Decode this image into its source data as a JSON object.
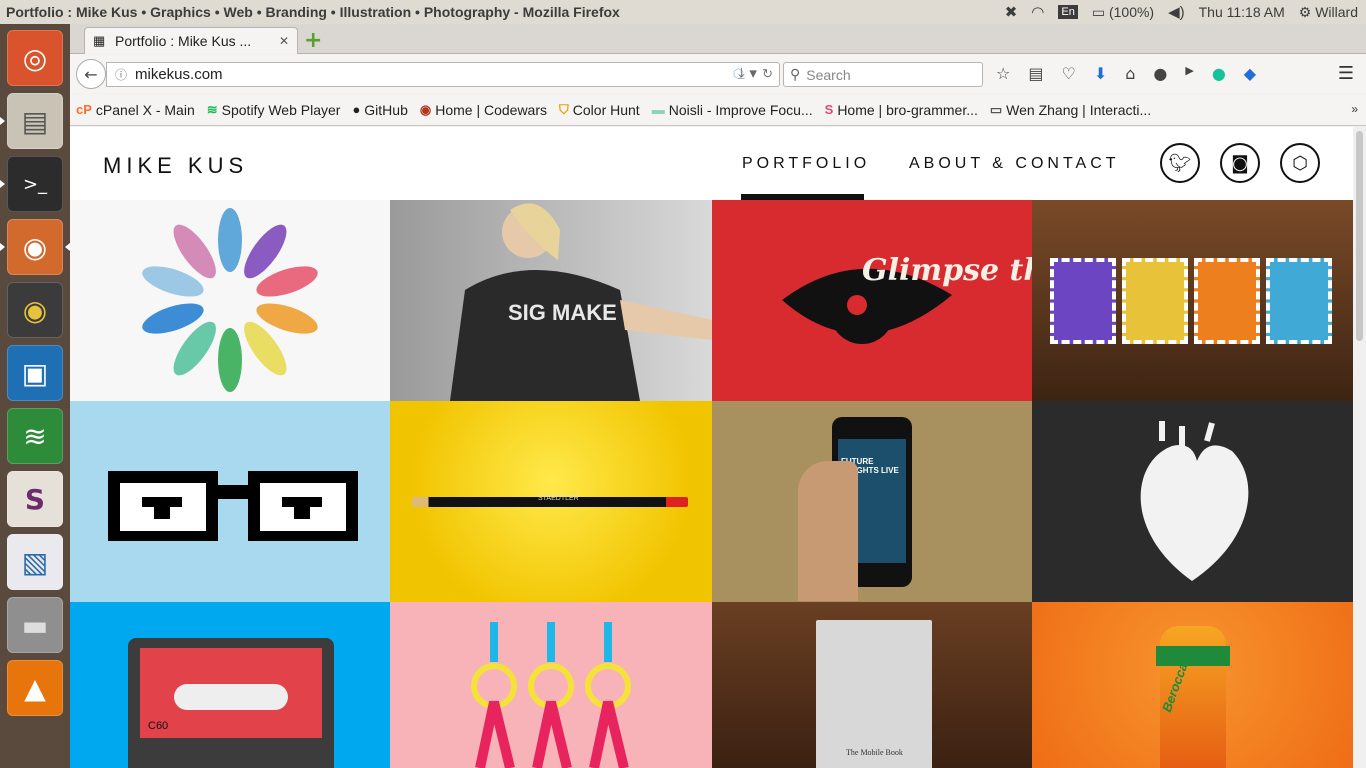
{
  "window": {
    "title": "Portfolio : Mike Kus • Graphics • Web • Branding • Illustration • Photography - Mozilla Firefox"
  },
  "indicators": {
    "lang": "En",
    "battery": "(100%)",
    "clock": "Thu 11:18 AM",
    "user": "Willard"
  },
  "launcher": {
    "items": [
      "ubuntu-dash",
      "files",
      "terminal",
      "firefox",
      "chrome",
      "app-grid",
      "spotify",
      "slack",
      "libreoffice-impress",
      "disk",
      "vlc"
    ]
  },
  "browser": {
    "tab_label": "Portfolio : Mike Kus ...",
    "url": "mikekus.com",
    "search_placeholder": "Search"
  },
  "bookmarks": [
    {
      "icon": "cP",
      "label": "cPanel X - Main",
      "color": "#ff6c2c"
    },
    {
      "icon": "≋",
      "label": "Spotify Web Player",
      "color": "#1db954"
    },
    {
      "icon": "●",
      "label": "GitHub",
      "color": "#222222"
    },
    {
      "icon": "◉",
      "label": "Home | Codewars",
      "color": "#b1361e"
    },
    {
      "icon": "⛉",
      "label": "Color Hunt",
      "color": "#e6a100"
    },
    {
      "icon": "▬",
      "label": "Noisli - Improve Focu...",
      "color": "#8fd3b6"
    },
    {
      "icon": "S",
      "label": "Home | bro-grammer...",
      "color": "#d94c7a"
    },
    {
      "icon": "▭",
      "label": "Wen Zhang | Interacti...",
      "color": "#555555"
    }
  ],
  "site": {
    "logo": "MIKE KUS",
    "nav": {
      "portfolio": "PORTFOLIO",
      "about": "ABOUT & CONTACT"
    },
    "social": [
      "twitter-icon",
      "instagram-icon",
      "dribbble-hex-icon"
    ]
  },
  "tiles": [
    {
      "name": "tile-leaves",
      "bg": "#f7f7f7",
      "text": ""
    },
    {
      "name": "tile-tshirt-photo",
      "bg": "#8c8c8c",
      "text": "SIG MAKE"
    },
    {
      "name": "tile-glimpse-future",
      "bg": "#d72b30",
      "text": "Glimpse the Future"
    },
    {
      "name": "tile-stamps",
      "bg": "#5a3a22",
      "text": ""
    },
    {
      "name": "tile-pixel-glasses",
      "bg": "#a9d9ee",
      "text": ""
    },
    {
      "name": "tile-pencil",
      "bg": "#f4cf00",
      "text": "STAEDTLER"
    },
    {
      "name": "tile-phone",
      "bg": "#a8905f",
      "text": "FUTURE INSIGHTS LIVE"
    },
    {
      "name": "tile-heart",
      "bg": "#2b2b2b",
      "text": ""
    },
    {
      "name": "tile-cassette",
      "bg": "#00a8ef",
      "text": "C60"
    },
    {
      "name": "tile-pink-rings",
      "bg": "#f7b3b8",
      "text": ""
    },
    {
      "name": "tile-mobile-book",
      "bg": "#5a3520",
      "text": "The Mobile Book"
    },
    {
      "name": "tile-berocca",
      "bg": "#f07a1e",
      "text": "Berocca"
    }
  ]
}
